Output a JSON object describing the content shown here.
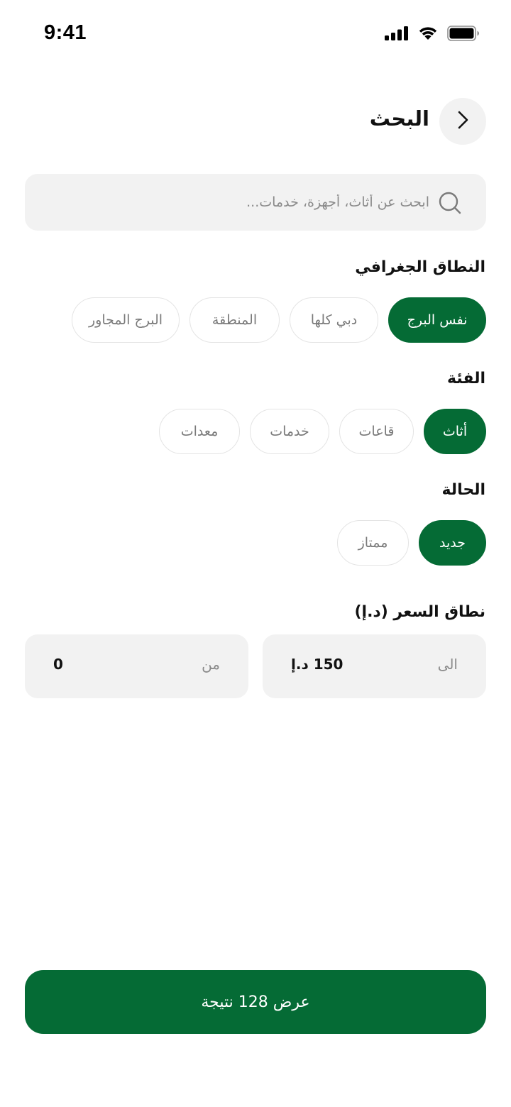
{
  "status_bar": {
    "time": "9:41"
  },
  "header": {
    "title": "البحث"
  },
  "search": {
    "placeholder": "ابحث عن أثاث، أجهزة، خدمات..."
  },
  "geo_range": {
    "label": "النطاق الجغرافي",
    "options": [
      "نفس البرج",
      "دبي كلها",
      "المنطقة",
      "البرج المجاور"
    ],
    "selected": "نفس البرج"
  },
  "category": {
    "label": "الفئة",
    "options": [
      "أثاث",
      "قاعات",
      "خدمات",
      "معدات"
    ],
    "selected": "أثاث"
  },
  "condition": {
    "label": "الحالة",
    "options": [
      "جديد",
      "ممتاز"
    ],
    "selected": "جديد"
  },
  "price": {
    "label": "نطاق السعر (د.إ)",
    "to_label": "الى",
    "to_value": "150 د.إ",
    "from_label": "من",
    "from_value": "0"
  },
  "results_button": {
    "label": "عرض 128 نتيجة"
  },
  "colors": {
    "accent": "#056b35",
    "field_bg": "#f2f2f2"
  }
}
